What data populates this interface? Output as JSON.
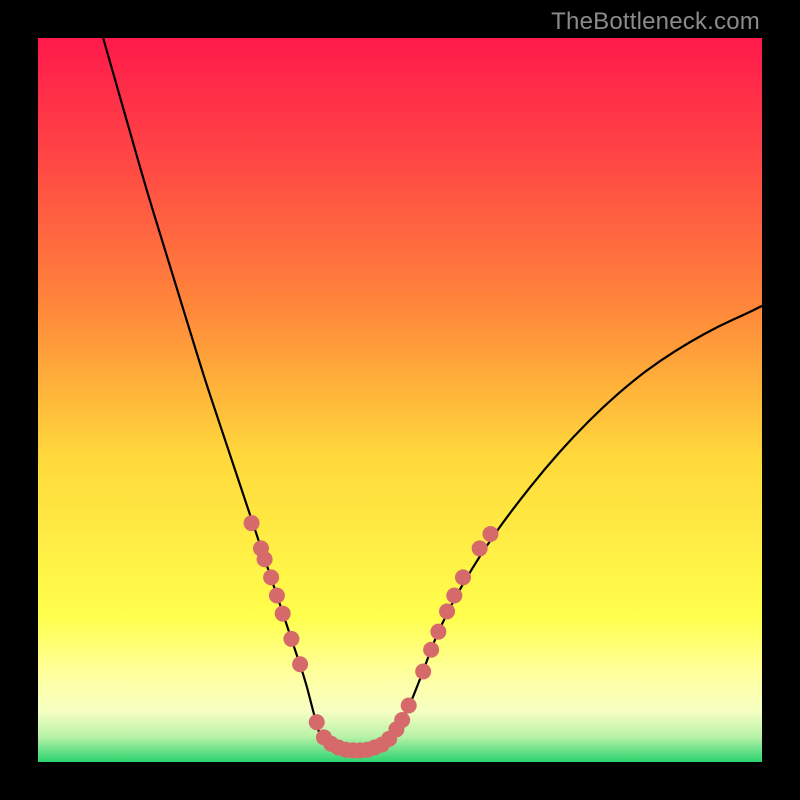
{
  "watermark": "TheBottleneck.com",
  "colors": {
    "bg_black": "#000000",
    "curve": "#000000",
    "marker": "#d66a6a",
    "grad_top": "#ff1a4b",
    "grad_mid1": "#ff6a3c",
    "grad_mid2": "#ffd93b",
    "grad_yellow": "#ffff4d",
    "grad_lightyellow": "#ffffa0",
    "grad_green": "#2bd46f"
  },
  "chart_data": {
    "type": "line",
    "title": "",
    "xlabel": "",
    "ylabel": "",
    "xlim": [
      0,
      100
    ],
    "ylim": [
      0,
      100
    ],
    "series": [
      {
        "name": "left-branch",
        "x": [
          9,
          11,
          13,
          15,
          17,
          19,
          21,
          23,
          25,
          27,
          29,
          31,
          32.5,
          34,
          35.5,
          37,
          38,
          39
        ],
        "y": [
          100,
          93,
          86,
          79,
          72.5,
          66,
          59.5,
          53,
          47,
          41,
          35,
          29,
          24.5,
          20,
          15.5,
          11,
          7,
          3.5
        ]
      },
      {
        "name": "valley-flat",
        "x": [
          39,
          41,
          43,
          45,
          47,
          49
        ],
        "y": [
          3.5,
          2.2,
          1.6,
          1.6,
          2.2,
          3.5
        ]
      },
      {
        "name": "right-branch",
        "x": [
          49,
          51,
          53,
          55,
          58,
          62,
          66,
          70,
          74,
          78,
          82,
          86,
          90,
          94,
          98,
          100
        ],
        "y": [
          3.5,
          7,
          12,
          17.5,
          23.5,
          30,
          35.5,
          40.5,
          45,
          49,
          52.5,
          55.5,
          58,
          60.2,
          62,
          63
        ]
      }
    ],
    "markers": [
      {
        "name": "left-cluster",
        "points": [
          {
            "x": 29.5,
            "y": 33
          },
          {
            "x": 30.8,
            "y": 29.5
          },
          {
            "x": 31.3,
            "y": 28
          },
          {
            "x": 32.2,
            "y": 25.5
          },
          {
            "x": 33.0,
            "y": 23
          },
          {
            "x": 33.8,
            "y": 20.5
          },
          {
            "x": 35.0,
            "y": 17
          },
          {
            "x": 36.2,
            "y": 13.5
          }
        ]
      },
      {
        "name": "valley-cluster",
        "points": [
          {
            "x": 38.5,
            "y": 5.5
          },
          {
            "x": 39.5,
            "y": 3.4
          },
          {
            "x": 40.5,
            "y": 2.5
          },
          {
            "x": 41.5,
            "y": 2.0
          },
          {
            "x": 42.5,
            "y": 1.7
          },
          {
            "x": 43.5,
            "y": 1.6
          },
          {
            "x": 44.5,
            "y": 1.6
          },
          {
            "x": 45.5,
            "y": 1.7
          },
          {
            "x": 46.5,
            "y": 2.0
          },
          {
            "x": 47.5,
            "y": 2.4
          },
          {
            "x": 48.5,
            "y": 3.2
          },
          {
            "x": 49.5,
            "y": 4.5
          },
          {
            "x": 50.3,
            "y": 5.8
          },
          {
            "x": 51.2,
            "y": 7.8
          }
        ]
      },
      {
        "name": "right-cluster",
        "points": [
          {
            "x": 53.2,
            "y": 12.5
          },
          {
            "x": 54.3,
            "y": 15.5
          },
          {
            "x": 55.3,
            "y": 18
          },
          {
            "x": 56.5,
            "y": 20.8
          },
          {
            "x": 57.5,
            "y": 23
          },
          {
            "x": 58.7,
            "y": 25.5
          },
          {
            "x": 61.0,
            "y": 29.5
          },
          {
            "x": 62.5,
            "y": 31.5
          }
        ]
      }
    ],
    "gradient_stops": [
      {
        "offset": 0.0,
        "color": "#ff1a4b"
      },
      {
        "offset": 0.18,
        "color": "#ff4a44"
      },
      {
        "offset": 0.38,
        "color": "#ff8a3a"
      },
      {
        "offset": 0.58,
        "color": "#ffd93b"
      },
      {
        "offset": 0.8,
        "color": "#ffff4d"
      },
      {
        "offset": 0.88,
        "color": "#ffffa0"
      },
      {
        "offset": 0.93,
        "color": "#f6ffc2"
      },
      {
        "offset": 0.965,
        "color": "#b8f2a8"
      },
      {
        "offset": 1.0,
        "color": "#2bd46f"
      }
    ]
  }
}
